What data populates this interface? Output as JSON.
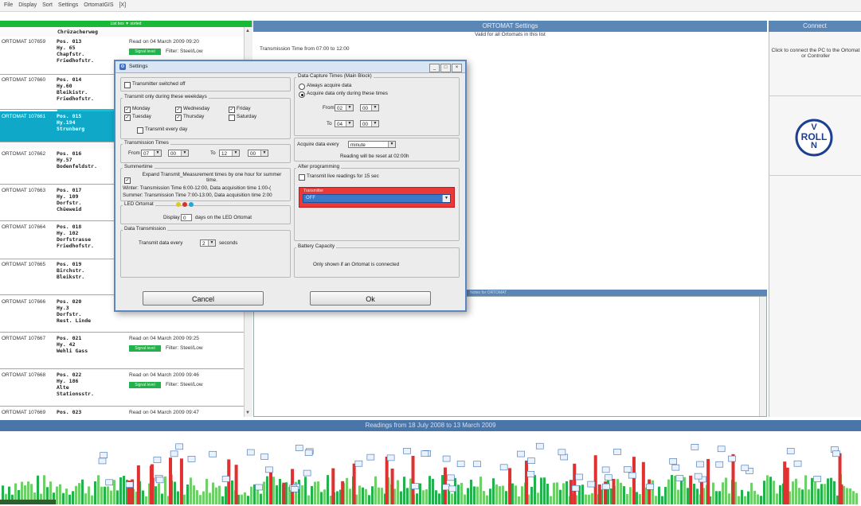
{
  "menu": [
    "File",
    "Display",
    "Sort",
    "Settings",
    "OrtomatGIS",
    "[X]"
  ],
  "list": {
    "header": "List box ▼ sorted",
    "first_name": "Chrüzacherweg",
    "entries": [
      {
        "id": "ORTOMAT 107659",
        "name": "Pos. 013\nHy. 65\nChapfstr.\nFriedhofstr.",
        "read": "Read on  04 March 2009   09:20",
        "badge": "Signal level",
        "filter": "Filter: Steel/Low"
      },
      {
        "id": "ORTOMAT 107660",
        "name": "Pos. 014\nHy.60\nBleikistr.\nFriedhofstr."
      },
      {
        "id": "ORTOMAT 107661",
        "name": "Pos. 015\nHy.194\nStrunberg"
      },
      {
        "id": "ORTOMAT 107662",
        "name": "Pos. 016\nHy.57\nBodenfeldstr."
      },
      {
        "id": "ORTOMAT 107663",
        "name": "Pos. 017\nHy. 109\nDorfstr.\nChüeweid"
      },
      {
        "id": "ORTOMAT 107664",
        "name": "Pos. 018\nHy. 102\nDorfstrasse\nFriedhofstr."
      },
      {
        "id": "ORTOMAT 107665",
        "name": "Pos. 019\nBirchstr.\nBleikstr."
      },
      {
        "id": "ORTOMAT 107666",
        "name": "Pos. 020\nHy.3\nDorfstr.\nRest. Linde"
      },
      {
        "id": "ORTOMAT 107667",
        "name": "Pos. 021\nHy. 42\nWehli Gass",
        "read": "Read on  04 March 2009    09:25",
        "badge": "Signal level",
        "filter": "Filter: Steel/Low"
      },
      {
        "id": "ORTOMAT 107668",
        "name": "Pos. 022\nHy. 186\nAlte\nStationsstr.",
        "read": "Read on  04 March 2009    09:46",
        "badge": "Signal level",
        "filter": "Filter: Steel/Low"
      },
      {
        "id": "ORTOMAT 107669",
        "name": "Pos. 023",
        "read": "Read on  04 March 2009    09:47"
      }
    ]
  },
  "center": {
    "title": "ORTOMAT Settings",
    "valid": "Valid for all Ortomats in this list",
    "tx_time": "Transmission Time from 07:00 to 12:00",
    "lower_title": "Notes for ORTOMAT"
  },
  "right": {
    "title": "Connect",
    "message": "Click to connect the PC to the Ortomat or Controller",
    "logo_top": "V",
    "logo_mid": "ROLL",
    "logo_bot": "N"
  },
  "readings": {
    "title": "Readings from 18 July 2008 to 13 March 2009",
    "tag": "12"
  },
  "dialog": {
    "title": "Settings",
    "transmitter_off": "Transmitter switched off",
    "weekdays_title": "Transmit only during these weekdays",
    "days": [
      "Monday",
      "Tuesday",
      "Wednesday",
      "Thursday",
      "Friday",
      "Saturday"
    ],
    "every_day": "Transmit every day",
    "tx_times_title": "Transmission Times",
    "from_label": "From",
    "to_label": "To",
    "tx_from_h": "07",
    "tx_from_m": "00",
    "tx_to_h": "12",
    "tx_to_m": "00",
    "summertime_title": "Summertime",
    "summertime_text": "Expand Transmit_Measurement times by one hour for summer time.",
    "winter_text": "Winter: Transmission Time 6:00-12:00, Data acquisition time 1:00-(",
    "summer_text": "Summer: Transmission Time 7:00-13:00, Data acquisition time 2:00",
    "led_title": "LED Ortomat",
    "display_label": "Display",
    "display_value": "0",
    "display_suffix": "days on the LED Ortomat",
    "data_tx_title": "Data Transmission",
    "data_tx_label": "Transmit data every",
    "data_tx_value": "2",
    "data_tx_unit": "seconds",
    "capture_title": "Data Capture Times (Main Block)",
    "always_acquire": "Always acquire data",
    "acquire_times": "Acquire data only during these times",
    "cap_from_h": "02",
    "cap_from_m": "00",
    "cap_to_h": "04",
    "cap_to_m": "00",
    "acquire_every_label": "Acquire data every",
    "acquire_every_value": "minute",
    "reset_note": "Reading will be reset at 02:00h",
    "after_title": "After programming",
    "live_readings": "Transmit live readings for 15 sec",
    "transmitter_title": "Transmitter",
    "transmitter_value": "OFF",
    "battery_title": "Battery Capacity",
    "battery_text": "Only shown if an Ortomat is connected",
    "cancel": "Cancel",
    "ok": "Ok"
  },
  "colors": {
    "accent": "#5b87b7",
    "green": "#22b14c",
    "red": "#e03030",
    "selected": "#0fa8c8"
  }
}
